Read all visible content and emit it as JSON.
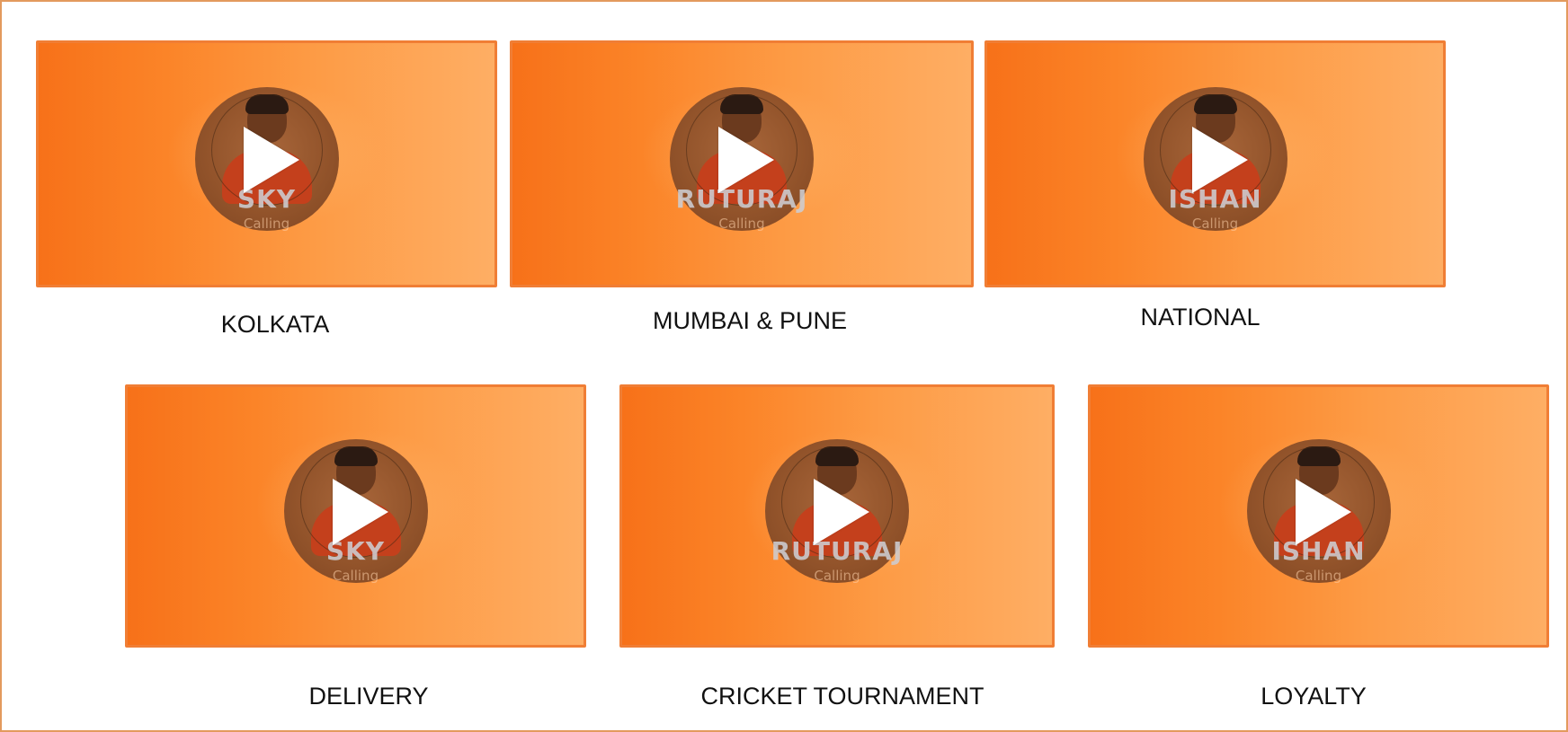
{
  "colors": {
    "card_border": "#f07e35",
    "card_gradient_start": "#f77119",
    "card_gradient_end": "#feae64",
    "page_border": "#e39a5e",
    "caption_text": "#111111",
    "play_icon": "#ffffff"
  },
  "videos": [
    {
      "thumb_name": "SKY",
      "thumb_sub": "Calling",
      "caption": "KOLKATA",
      "icon": "play-icon"
    },
    {
      "thumb_name": "RUTURAJ",
      "thumb_sub": "Calling",
      "caption": "MUMBAI & PUNE",
      "icon": "play-icon"
    },
    {
      "thumb_name": "ISHAN",
      "thumb_sub": "Calling",
      "caption": "NATIONAL",
      "icon": "play-icon"
    },
    {
      "thumb_name": "SKY",
      "thumb_sub": "Calling",
      "caption": "DELIVERY",
      "icon": "play-icon"
    },
    {
      "thumb_name": "RUTURAJ",
      "thumb_sub": "Calling",
      "caption": "CRICKET TOURNAMENT",
      "icon": "play-icon"
    },
    {
      "thumb_name": "ISHAN",
      "thumb_sub": "Calling",
      "caption": "LOYALTY",
      "icon": "play-icon"
    }
  ]
}
